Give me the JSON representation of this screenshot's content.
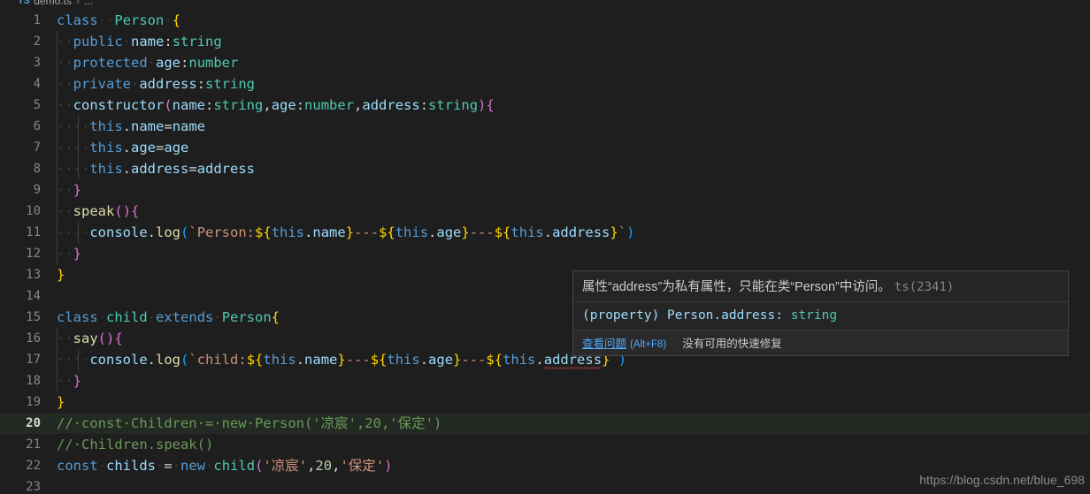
{
  "breadcrumb": {
    "file_icon": "TS",
    "file": "demo.ts",
    "separator": "›",
    "dots": "..."
  },
  "editor": {
    "language": "typescript",
    "active_line": 20,
    "lines": [
      {
        "n": "1",
        "text": "class  Person {"
      },
      {
        "n": "2",
        "text": "  public name:string"
      },
      {
        "n": "3",
        "text": "  protected age:number"
      },
      {
        "n": "4",
        "text": "  private address:string"
      },
      {
        "n": "5",
        "text": "  constructor(name:string,age:number,address:string){"
      },
      {
        "n": "6",
        "text": "    this.name=name"
      },
      {
        "n": "7",
        "text": "    this.age=age"
      },
      {
        "n": "8",
        "text": "    this.address=address"
      },
      {
        "n": "9",
        "text": "  }"
      },
      {
        "n": "10",
        "text": "  speak(){"
      },
      {
        "n": "11",
        "text": "    console.log(`Person:${this.name}---${this.age}---${this.address}`)"
      },
      {
        "n": "12",
        "text": "  }"
      },
      {
        "n": "13",
        "text": "}"
      },
      {
        "n": "14",
        "text": ""
      },
      {
        "n": "15",
        "text": "class child extends Person{"
      },
      {
        "n": "16",
        "text": "  say(){"
      },
      {
        "n": "17",
        "text": "    console.log(`child:${this.name}---${this.age}---${this.address}`)"
      },
      {
        "n": "18",
        "text": "  }"
      },
      {
        "n": "19",
        "text": "}"
      },
      {
        "n": "20",
        "text": "// const Children = new Person('凉宸',20,'保定')"
      },
      {
        "n": "21",
        "text": "// Children.speak()"
      },
      {
        "n": "22",
        "text": "const childs = new child('凉宸',20,'保定')"
      },
      {
        "n": "23",
        "text": ""
      }
    ],
    "error": {
      "token": "address",
      "line": 17,
      "color": "#f14c4c"
    }
  },
  "tooltip": {
    "message": "属性“address”为私有属性，只能在类“Person”中访问。",
    "code": "ts(2341)",
    "signature_prefix": "(property) ",
    "signature_name": "Person.address: ",
    "signature_type": "string",
    "view_problem_link": "查看问题",
    "view_problem_shortcut": "(Alt+F8)",
    "no_fix_text": "没有可用的快速修复"
  },
  "watermark": {
    "text": "https://blog.csdn.net/blue_698"
  },
  "colors": {
    "background": "#1e1e1e",
    "active_line": "#232a23",
    "keyword": "#569cd6",
    "type": "#4ec9b0",
    "variable": "#9cdcfe",
    "function": "#dcdcaa",
    "string": "#ce9178",
    "number": "#b5cea8",
    "comment": "#6a9955",
    "error": "#f14c4c",
    "link": "#4daafc",
    "tooltip_bg": "#252526",
    "tooltip_border": "#454545"
  }
}
